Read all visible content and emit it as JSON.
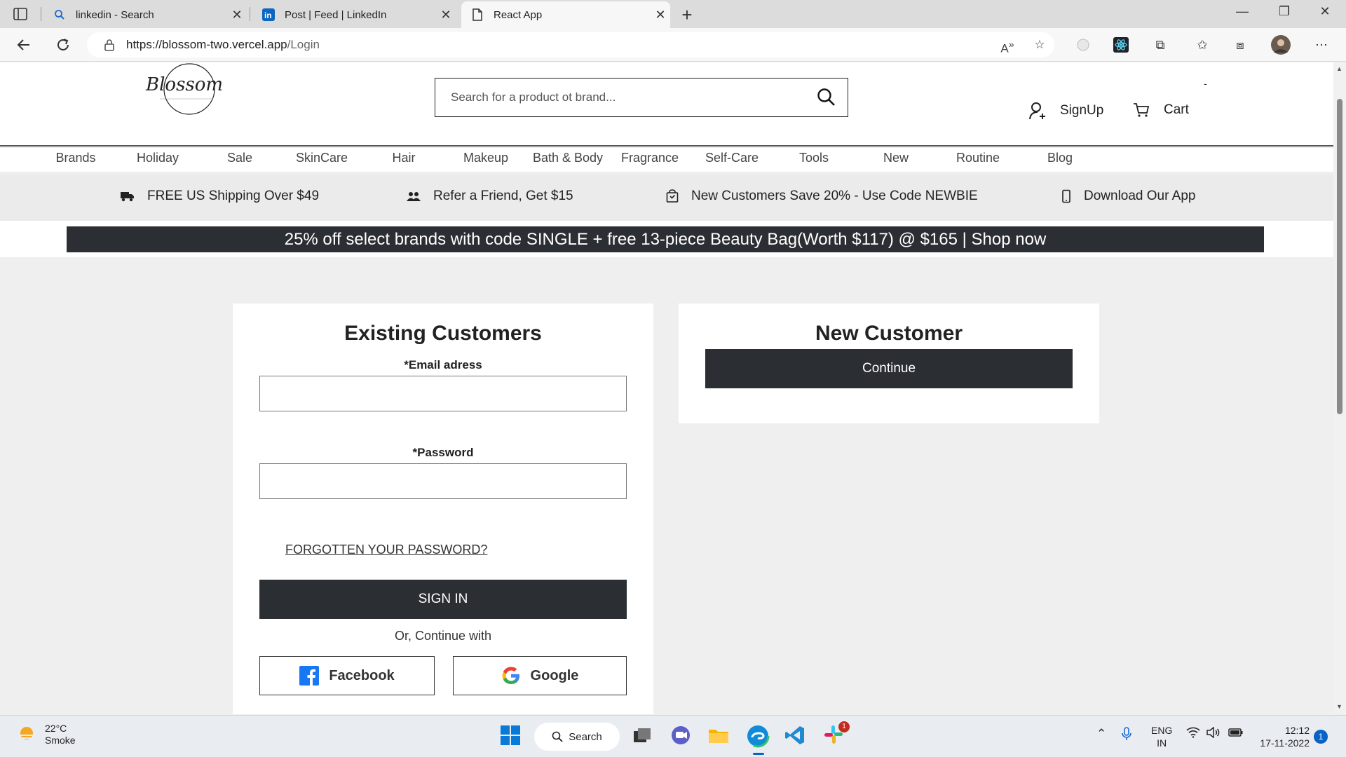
{
  "browser": {
    "tabs": [
      {
        "title": "linkedin - Search",
        "icon": "search-icon"
      },
      {
        "title": "Post | Feed | LinkedIn",
        "icon": "linkedin-icon"
      },
      {
        "title": "React App",
        "icon": "document-icon"
      }
    ],
    "url_host": "https://blossom-two.vercel.app",
    "url_path": "/Login"
  },
  "site": {
    "logo_text": "Blossom",
    "search_placeholder": "Search for a product ot brand...",
    "signup_label": "SignUp",
    "cart_label": "Cart",
    "cart_count": "-",
    "nav": [
      "Brands",
      "Holiday",
      "Sale",
      "SkinCare",
      "Hair",
      "Makeup",
      "Bath & Body",
      "Fragrance",
      "Self-Care",
      "Tools",
      "New",
      "Routine",
      "Blog"
    ],
    "perks": [
      {
        "text": "FREE US Shipping Over $49",
        "icon": "truck-icon"
      },
      {
        "text": "Refer a Friend, Get $15",
        "icon": "people-icon"
      },
      {
        "text": "New Customers Save 20% - Use Code NEWBIE",
        "icon": "shopping-bag-icon"
      },
      {
        "text": "Download Our App",
        "icon": "phone-icon"
      }
    ],
    "promo": "25% off select brands with code SINGLE + free 13-piece Beauty Bag(Worth $117) @ $165 | Shop now"
  },
  "login": {
    "title": "Existing Customers",
    "email_label": "*Email adress",
    "email_value": "",
    "password_label": "*Password",
    "password_value": "",
    "forgot_label": "FORGOTTEN YOUR PASSWORD?",
    "signin_label": "SIGN IN",
    "or_label": "Or, Continue with",
    "facebook_label": "Facebook",
    "google_label": "Google"
  },
  "new_customer": {
    "title": "New Customer",
    "continue_label": "Continue"
  },
  "taskbar": {
    "temperature": "22°C",
    "weather": "Smoke",
    "search_label": "Search",
    "slack_badge": "1",
    "lang_top": "ENG",
    "lang_bottom": "IN",
    "time": "12:12",
    "date": "17-11-2022",
    "notifications": "1"
  }
}
